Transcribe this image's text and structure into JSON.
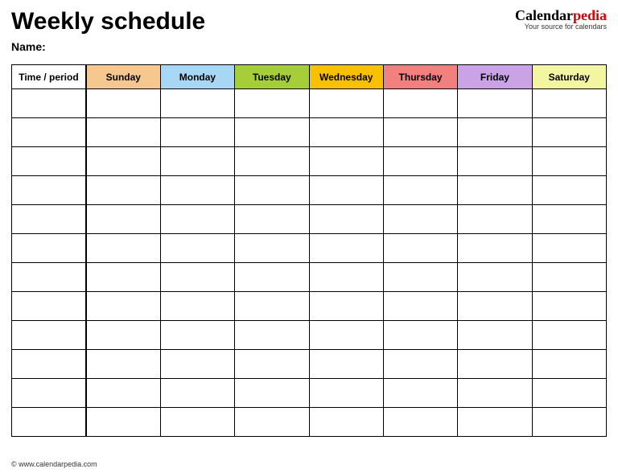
{
  "header": {
    "title": "Weekly schedule",
    "name_label": "Name:",
    "brand": {
      "part1": "Calendar",
      "part2": "pedia",
      "tagline": "Your source for calendars"
    }
  },
  "table": {
    "time_header": "Time / period",
    "days": [
      {
        "label": "Sunday",
        "color": "#f6c78f"
      },
      {
        "label": "Monday",
        "color": "#a7d7f4"
      },
      {
        "label": "Tuesday",
        "color": "#a5ce39"
      },
      {
        "label": "Wednesday",
        "color": "#f9c000"
      },
      {
        "label": "Thursday",
        "color": "#f2807f"
      },
      {
        "label": "Friday",
        "color": "#c9a3e6"
      },
      {
        "label": "Saturday",
        "color": "#f3f5a0"
      }
    ],
    "row_count": 12
  },
  "footer": {
    "copyright": "© www.calendarpedia.com"
  }
}
